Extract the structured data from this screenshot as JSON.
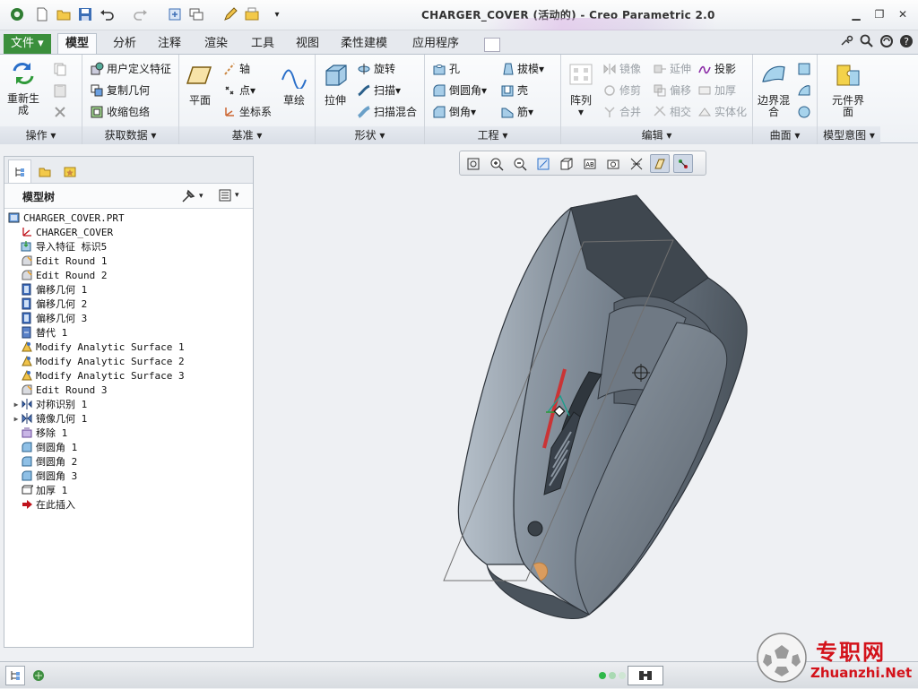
{
  "window": {
    "title": "CHARGER_COVER (活动的) - Creo Parametric 2.0"
  },
  "tabs": [
    "文件",
    "模型",
    "分析",
    "注释",
    "渲染",
    "工具",
    "视图",
    "柔性建模",
    "应用程序"
  ],
  "active_tab": "模型",
  "ribbon": {
    "operations": {
      "label": "操作",
      "regenerate": "重新生成"
    },
    "get_data": {
      "label": "获取数据",
      "items": [
        "用户定义特征",
        "复制几何",
        "收缩包络"
      ]
    },
    "datum": {
      "label": "基准",
      "plane": "平面",
      "axis": "轴",
      "point": "点",
      "csys": "坐标系",
      "sketch": "草绘"
    },
    "shapes": {
      "label": "形状",
      "extrude": "拉伸",
      "revolve": "旋转",
      "sweep": "扫描",
      "swept_blend": "扫描混合"
    },
    "engineering": {
      "label": "工程",
      "hole": "孔",
      "round": "倒圆角",
      "chamfer": "倒角",
      "draft": "拔模",
      "shell": "壳",
      "rib": "筋"
    },
    "editing": {
      "label": "编辑",
      "pattern": "阵列",
      "mirror": "镜像",
      "trim": "修剪",
      "merge": "合并",
      "extend": "延伸",
      "offset": "偏移",
      "intersect": "相交",
      "project": "投影",
      "thicken": "加厚",
      "solidify": "实体化"
    },
    "surfaces": {
      "label": "曲面",
      "boundary_blend": "边界混合"
    },
    "model_intent": {
      "label": "模型意图",
      "component_interface": "元件界面"
    }
  },
  "model_tree": {
    "title": "模型树",
    "items": [
      {
        "label": "CHARGER_COVER.PRT",
        "icon": "part-icon",
        "indent": 0,
        "expander": ""
      },
      {
        "label": "CHARGER_COVER",
        "icon": "csys-icon",
        "indent": 1,
        "expander": ""
      },
      {
        "label": "导入特征 标识5",
        "icon": "import-feature-icon",
        "indent": 1,
        "expander": ""
      },
      {
        "label": "Edit Round 1",
        "icon": "edit-round-icon",
        "indent": 1,
        "expander": ""
      },
      {
        "label": "Edit Round 2",
        "icon": "edit-round-icon",
        "indent": 1,
        "expander": ""
      },
      {
        "label": "偏移几何 1",
        "icon": "offset-geometry-icon",
        "indent": 1,
        "expander": ""
      },
      {
        "label": "偏移几何 2",
        "icon": "offset-geometry-icon",
        "indent": 1,
        "expander": ""
      },
      {
        "label": "偏移几何 3",
        "icon": "offset-geometry-icon",
        "indent": 1,
        "expander": ""
      },
      {
        "label": "替代 1",
        "icon": "substitute-icon",
        "indent": 1,
        "expander": ""
      },
      {
        "label": "Modify Analytic Surface 1",
        "icon": "modify-surface-icon",
        "indent": 1,
        "expander": ""
      },
      {
        "label": "Modify Analytic Surface 2",
        "icon": "modify-surface-icon",
        "indent": 1,
        "expander": ""
      },
      {
        "label": "Modify Analytic Surface 3",
        "icon": "modify-surface-icon",
        "indent": 1,
        "expander": ""
      },
      {
        "label": "Edit Round 3",
        "icon": "edit-round-icon",
        "indent": 1,
        "expander": ""
      },
      {
        "label": "对称识别 1",
        "icon": "symmetry-recognition-icon",
        "indent": 1,
        "expander": "▶"
      },
      {
        "label": "镜像几何 1",
        "icon": "mirror-geometry-icon",
        "indent": 1,
        "expander": "▶"
      },
      {
        "label": "移除 1",
        "icon": "remove-icon",
        "indent": 1,
        "expander": ""
      },
      {
        "label": "倒圆角 1",
        "icon": "round-icon",
        "indent": 1,
        "expander": ""
      },
      {
        "label": "倒圆角 2",
        "icon": "round-icon",
        "indent": 1,
        "expander": ""
      },
      {
        "label": "倒圆角 3",
        "icon": "round-icon",
        "indent": 1,
        "expander": ""
      },
      {
        "label": "加厚 1",
        "icon": "thicken-icon",
        "indent": 1,
        "expander": ""
      },
      {
        "label": "在此插入",
        "icon": "insert-here-icon",
        "indent": 1,
        "expander": ""
      }
    ]
  },
  "watermark": {
    "brand": "专职网",
    "url": "Zhuanzhi.Net"
  },
  "colors": {
    "accent": "#2a6fc9",
    "ribbon_bg": "#eef1f5",
    "model_body": "#7b8794",
    "insert_arrow": "#c0141c",
    "watermark_red": "#d3121a"
  }
}
